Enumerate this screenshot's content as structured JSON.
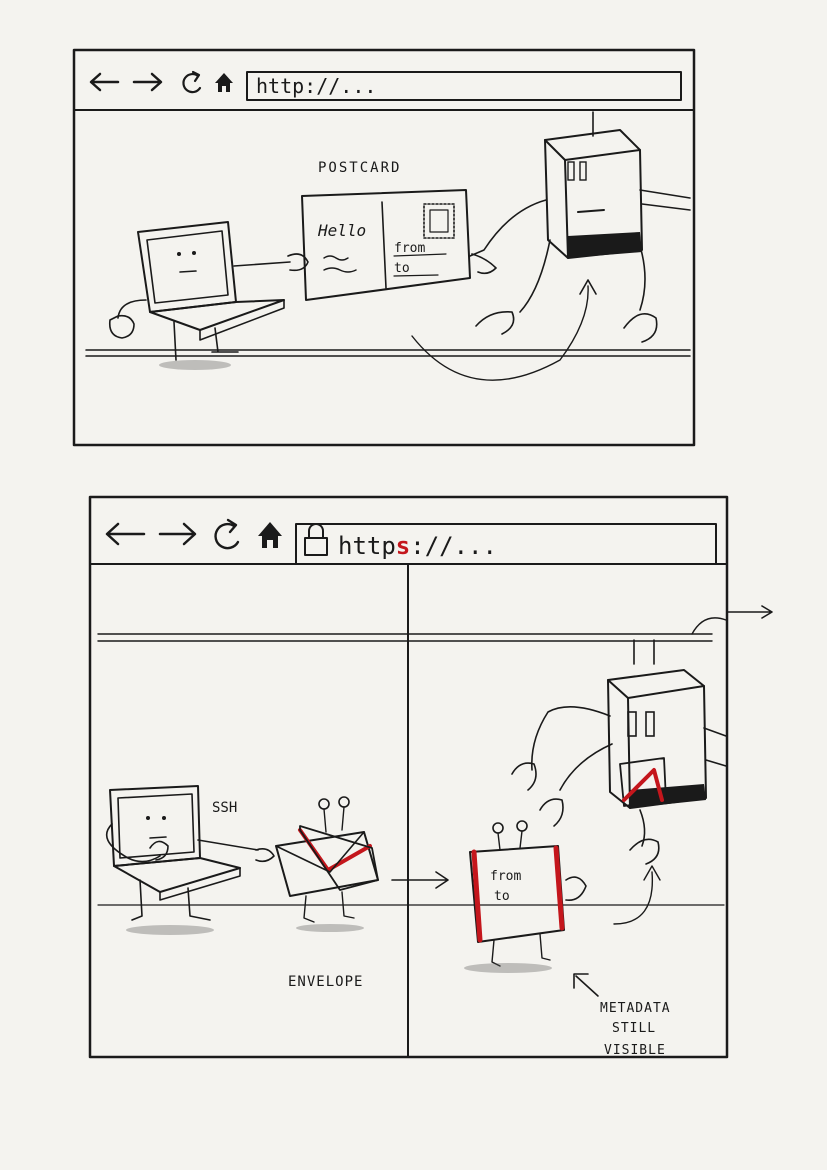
{
  "panel_top": {
    "address_text": "http://...",
    "nav": [
      "back-arrow-icon",
      "forward-arrow-icon",
      "reload-icon",
      "home-icon"
    ],
    "label_postcard": "POSTCARD",
    "postcard": {
      "greeting": "Hello",
      "from": "from",
      "to": "to"
    }
  },
  "panel_bottom": {
    "address_prefix": "http",
    "address_secure": "s",
    "address_suffix": "://...",
    "nav": [
      "back-arrow-icon",
      "forward-arrow-icon",
      "reload-icon",
      "home-icon",
      "padlock-icon"
    ],
    "label_ssh": "SSH",
    "label_envelope": "ENVELOPE",
    "envelope": {
      "from": "from",
      "to": "to"
    },
    "metadata_lines": [
      "METADATA",
      "STILL",
      "VISIBLE"
    ]
  },
  "colors": {
    "ink": "#1a1a1a",
    "accent": "#c4161c",
    "paper": "#f4f3ef"
  }
}
